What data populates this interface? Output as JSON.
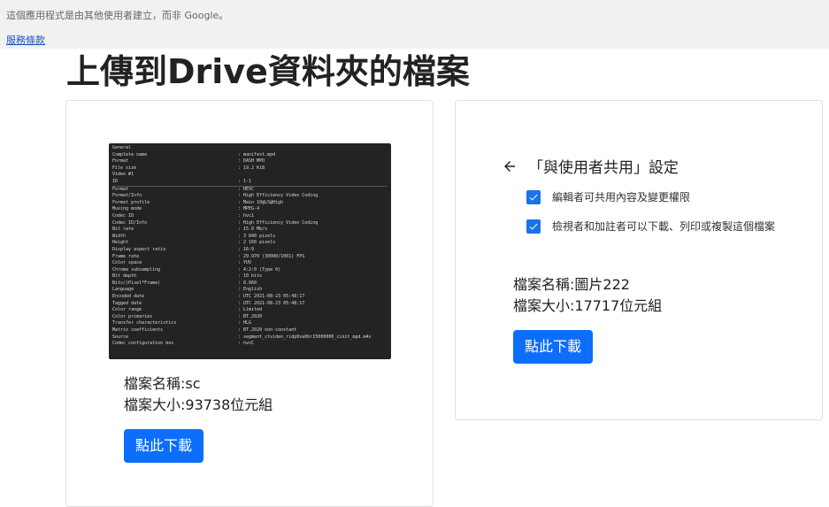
{
  "banner": {
    "notice": "這個應用程式是由其他使用者建立，而非 Google。",
    "terms_link": "服務條款"
  },
  "page": {
    "title_prefix": "上傳到",
    "title_drive": "Drive",
    "title_suffix": "資料夾的檔案"
  },
  "files": [
    {
      "name_line": "檔案名稱:sc",
      "size_line": "檔案大小:93738位元組",
      "download_label": "點此下載",
      "thumbnail_rows": [
        [
          "General",
          ""
        ],
        [
          "Complete name",
          ": manifest.mpd"
        ],
        [
          "Format",
          ": DASH MPD"
        ],
        [
          "File size",
          ": 19.2 KiB"
        ],
        [
          "",
          ""
        ],
        [
          "Video #1",
          ""
        ],
        [
          "ID",
          ": 1-1"
        ],
        [
          "Format",
          ": HEVC"
        ],
        [
          "Format/Info",
          ": High Efficiency Video Coding"
        ],
        [
          "Format profile",
          ": Main 10@L5@High"
        ],
        [
          "Muxing mode",
          ": MPEG-4"
        ],
        [
          "Codec ID",
          ": hvc1"
        ],
        [
          "Codec ID/Info",
          ": High Efficiency Video Coding"
        ],
        [
          "Bit rate",
          ": 15.0 Mb/s"
        ],
        [
          "Width",
          ": 3 840 pixels"
        ],
        [
          "Height",
          ": 2 160 pixels"
        ],
        [
          "Display aspect ratio",
          ": 16:9"
        ],
        [
          "Frame rate",
          ": 29.970 (30000/1001) FPS"
        ],
        [
          "Color space",
          ": YUV"
        ],
        [
          "Chroma subsampling",
          ": 4:2:0 (Type 0)"
        ],
        [
          "Bit depth",
          ": 10 bits"
        ],
        [
          "Bits/(Pixel*Frame)",
          ": 0.060"
        ],
        [
          "Language",
          ": English"
        ],
        [
          "Encoded date",
          ": UTC 2021-08-23 05:48:17"
        ],
        [
          "Tagged date",
          ": UTC 2021-08-23 05:48:17"
        ],
        [
          "Color range",
          ": Limited"
        ],
        [
          "Color primaries",
          ": BT.2020"
        ],
        [
          "Transfer characteristics",
          ": HLG"
        ],
        [
          "Matrix coefficients",
          ": BT.2020 non-constant"
        ],
        [
          "Source",
          ": segment_ctvideo_ridp0va0br15000000_cinit_mpd.m4s"
        ],
        [
          "Codec configuration box",
          ": hvcC"
        ]
      ]
    },
    {
      "name_line": "檔案名稱:圖片222",
      "size_line": "檔案大小:17717位元組",
      "download_label": "點此下載",
      "share_panel": {
        "title": "「與使用者共用」設定",
        "options": [
          "編輯者可共用內容及變更權限",
          "檢視者和加註者可以下載、列印或複製這個檔案"
        ]
      }
    }
  ],
  "colors": {
    "primary_button": "#0d6efd",
    "checkbox": "#1a73e8",
    "banner_bg": "#f1f1f1",
    "link": "#1a55c4"
  }
}
